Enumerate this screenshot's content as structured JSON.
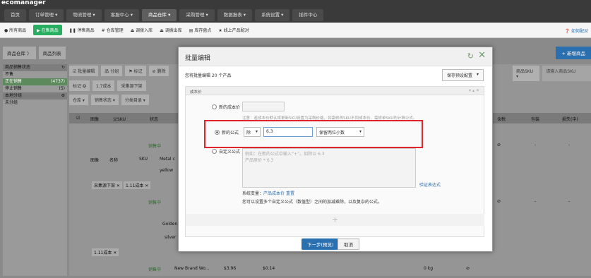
{
  "app": {
    "brand": "ecomanager"
  },
  "topnav": [
    "首页",
    "订单管理 ▾",
    "物流管理 ▾",
    "客服中心 ▾",
    "商品仓库 ▾",
    "采购管理 ▾",
    "数据报表 ▾",
    "系统设置 ▾",
    "插件中心"
  ],
  "subnav": [
    "● 所有商品",
    "▶ 在售商品",
    "❚❚ 停售商品",
    "# 仓库管理",
    "⏏ 调拨入库",
    "⏏ 调拨出库",
    "▤ 库存盘点",
    "★ 线上产品配对"
  ],
  "help": "❓ 如何配对",
  "breadcrumb": [
    "商品仓库 〉",
    "商品列表"
  ],
  "new_button": "+ 新增商品",
  "sidebar": {
    "header": "商品销售状态",
    "items": [
      {
        "label": "不售",
        "count": ""
      },
      {
        "label": "正在销售",
        "count": "(4737)"
      },
      {
        "label": "停止销售",
        "count": "(5)"
      }
    ],
    "group_header": "本地分组",
    "group_item": "未分组"
  },
  "toolbar": [
    "☑ 批量编辑",
    "品 分组",
    "⚑ 标记",
    "⊘ 删除"
  ],
  "filters": [
    "仓库 ▾",
    "销售状态 ▾",
    "分类目录 ▾"
  ],
  "sku_select": "商品SKU ▾",
  "sku_search_placeholder": "请输入商品SKU",
  "tag_label": "标记 ✪",
  "tag1": "1.7成本",
  "tag2": "采集源下架",
  "columns": [
    "图像",
    "父SKU",
    "状态",
    "含税",
    "包装",
    "损失(中)"
  ],
  "rows": {
    "status": "销售中",
    "dash": "-",
    "empty_sym": "⊘",
    "product_name": "New Brand Wo...",
    "price": "$3.96",
    "cost": "$0.14",
    "weight": "0 kg"
  },
  "subheader": [
    "图像",
    "名称",
    "SKU",
    "Metal c"
  ],
  "subcell1": "yellow",
  "subcell2": "Golden",
  "subcell3": "silver",
  "chip1": "采集源下架 ✕",
  "chip2": "1.11成本 ✕",
  "chip3": "1.11成本 ✕",
  "modal": {
    "title": "批量编辑",
    "subtitle": "您将批量编辑 20 个产品",
    "preset": "保存预设配置",
    "section": "成本价",
    "opt1": "新的成本价",
    "opt1_note": "注意：若成本价默认将更新SKU设置为采购价格，如需修改SKU不同成本价，需修单SKU的计算公式。",
    "opt2": "新的公式",
    "op_select": "除",
    "formula_value": "6.3",
    "precision": "保留两位小数",
    "opt3": "自定义公式",
    "custom_placeholder": "例如：在新的公式中输入“+”。如除以 6.3\n产品原价 * 6.3",
    "verify": "验证表达式",
    "sys_label": "系统变量：",
    "sys_var": "产品成本价",
    "sys_reset": "重置",
    "sys_help": "您可以设置多个自定义公式（数值型）之间的加减乘除，以及复杂的公式。",
    "next": "下一步(预览)",
    "cancel": "取消"
  }
}
